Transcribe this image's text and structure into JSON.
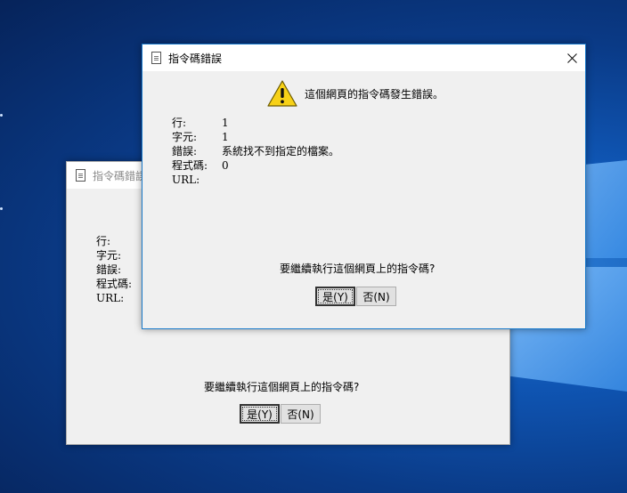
{
  "front_dialog": {
    "title": "指令碼錯誤",
    "heading": "這個網頁的指令碼發生錯誤。",
    "labels": {
      "line": "行:",
      "char": "字元:",
      "error": "錯誤:",
      "code": "程式碼:",
      "url": "URL:"
    },
    "values": {
      "line": "1",
      "char": "1",
      "error": "系統找不到指定的檔案。",
      "code": "0",
      "url": ""
    },
    "question": "要繼續執行這個網頁上的指令碼?",
    "yes_label": "是(Y)",
    "no_label": "否(N)"
  },
  "back_dialog": {
    "title": "指令碼錯誤",
    "labels": {
      "line": "行:",
      "char": "字元:",
      "error": "錯誤:",
      "code": "程式碼:",
      "url": "URL:"
    },
    "question": "要繼續執行這個網頁上的指令碼?",
    "yes_label": "是(Y)",
    "no_label": "否(N)"
  },
  "colors": {
    "accent_border": "#1979ca",
    "dialog_bg": "#f0f0f0",
    "warning_yellow": "#f7d117"
  }
}
